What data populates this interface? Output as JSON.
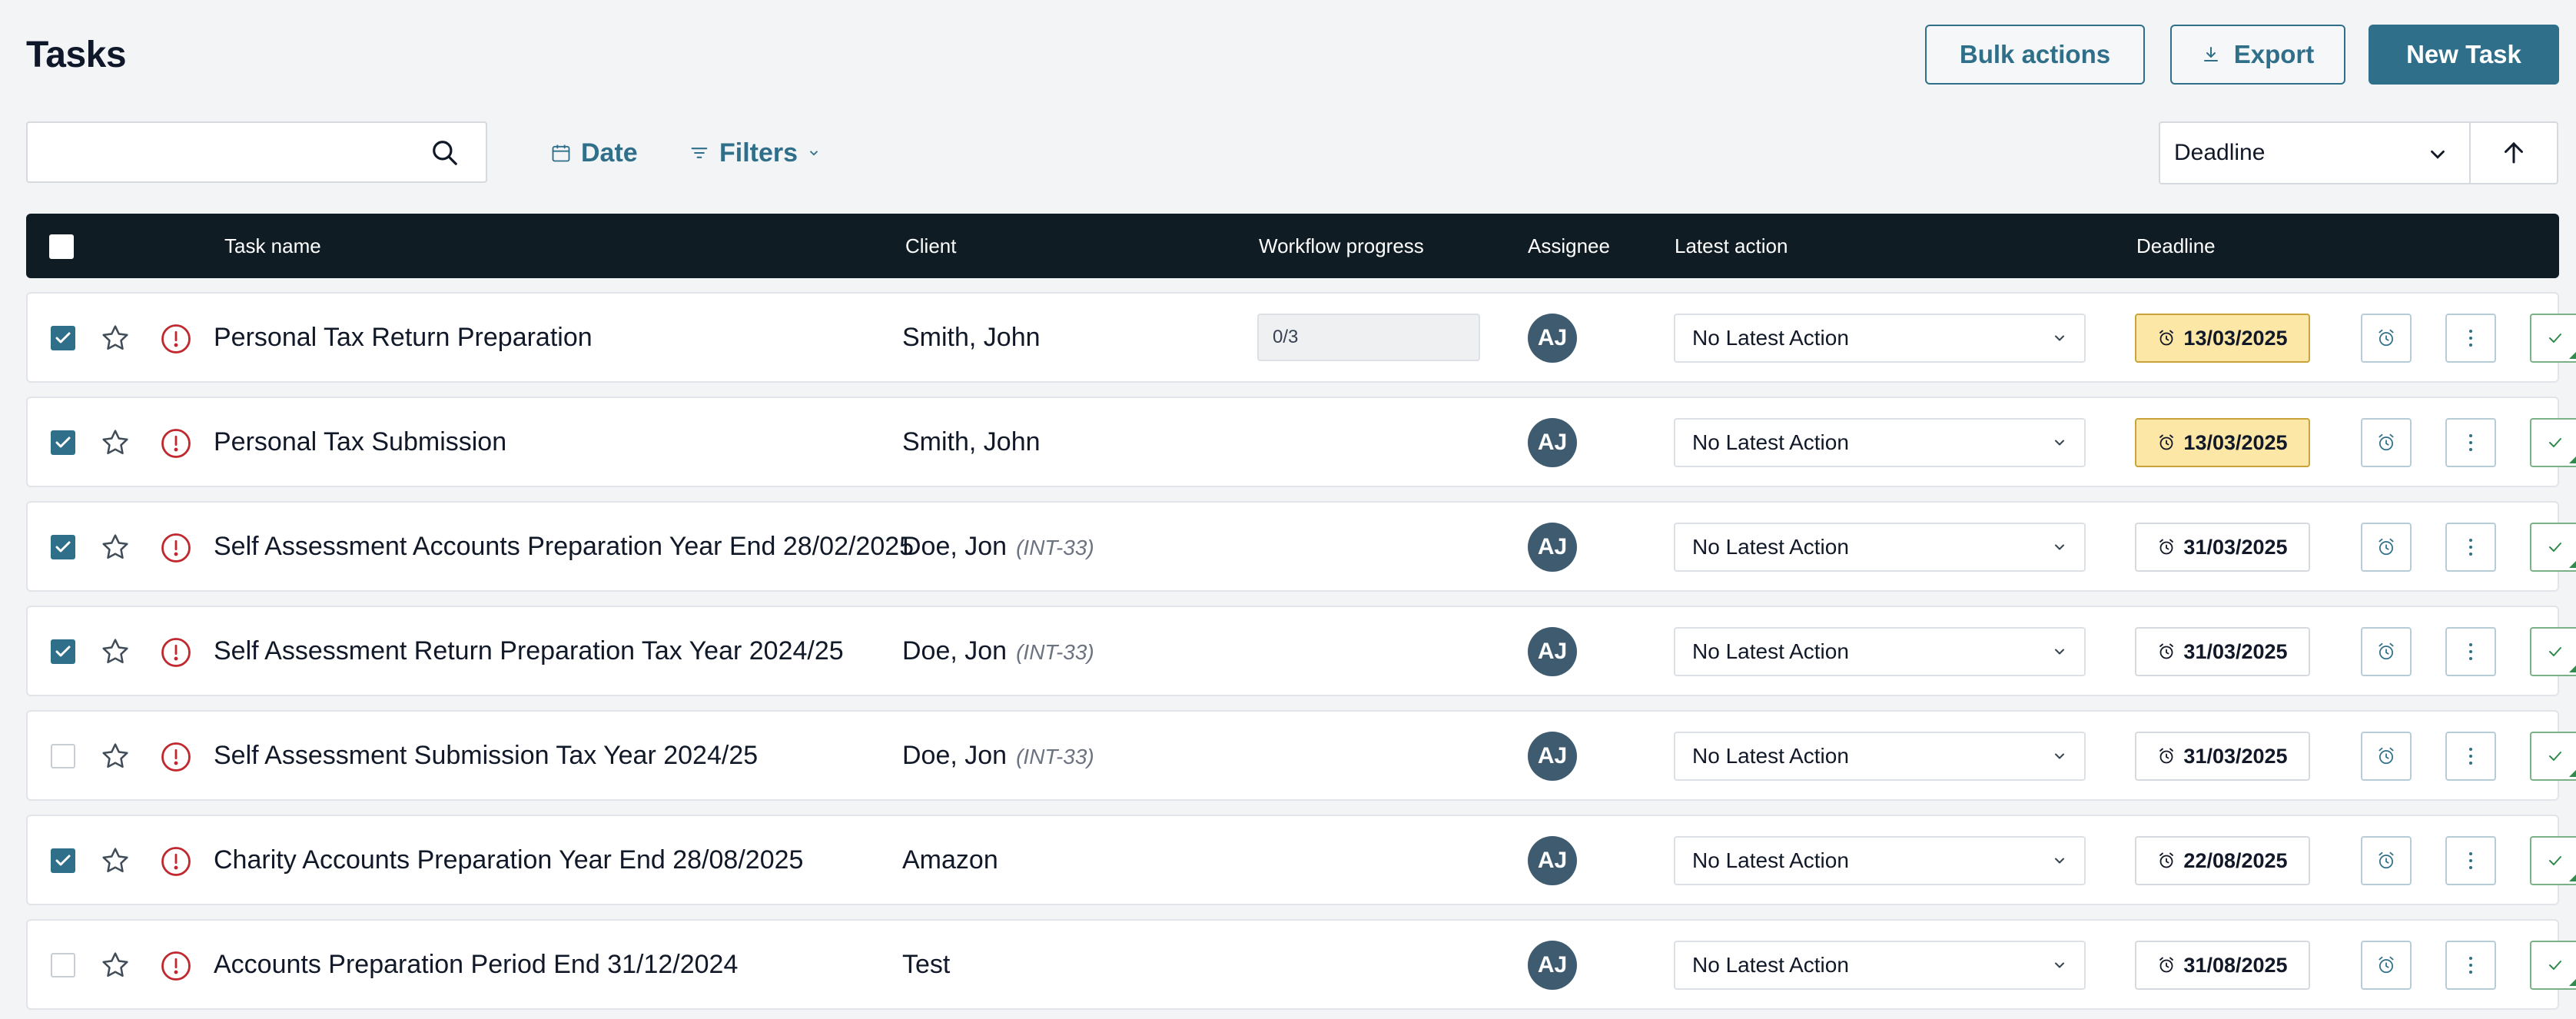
{
  "header": {
    "title": "Tasks",
    "bulk_actions_label": "Bulk actions",
    "export_label": "Export",
    "new_task_label": "New Task"
  },
  "toolbar": {
    "search_value": "",
    "date_label": "Date",
    "filters_label": "Filters",
    "sort_by": "Deadline"
  },
  "table": {
    "columns": {
      "task_name": "Task name",
      "client": "Client",
      "workflow_progress": "Workflow progress",
      "assignee": "Assignee",
      "latest_action": "Latest action",
      "deadline": "Deadline"
    },
    "rows": [
      {
        "checked": true,
        "name": "Personal Tax Return Preparation",
        "client": "Smith, John",
        "client_ref": "",
        "progress": "0/3",
        "assignee": "AJ",
        "latest_action": "No Latest Action",
        "deadline": "13/03/2025",
        "deadline_warning": true
      },
      {
        "checked": true,
        "name": "Personal Tax Submission",
        "client": "Smith, John",
        "client_ref": "",
        "progress": "",
        "assignee": "AJ",
        "latest_action": "No Latest Action",
        "deadline": "13/03/2025",
        "deadline_warning": true
      },
      {
        "checked": true,
        "name": "Self Assessment Accounts Preparation Year End 28/02/2025",
        "client": "Doe, Jon",
        "client_ref": "(INT-33)",
        "progress": "",
        "assignee": "AJ",
        "latest_action": "No Latest Action",
        "deadline": "31/03/2025",
        "deadline_warning": false
      },
      {
        "checked": true,
        "name": "Self Assessment Return Preparation Tax Year 2024/25",
        "client": "Doe, Jon",
        "client_ref": "(INT-33)",
        "progress": "",
        "assignee": "AJ",
        "latest_action": "No Latest Action",
        "deadline": "31/03/2025",
        "deadline_warning": false
      },
      {
        "checked": false,
        "name": "Self Assessment Submission Tax Year 2024/25",
        "client": "Doe, Jon",
        "client_ref": "(INT-33)",
        "progress": "",
        "assignee": "AJ",
        "latest_action": "No Latest Action",
        "deadline": "31/03/2025",
        "deadline_warning": false
      },
      {
        "checked": true,
        "name": "Charity Accounts Preparation Year End 28/08/2025",
        "client": "Amazon",
        "client_ref": "",
        "progress": "",
        "assignee": "AJ",
        "latest_action": "No Latest Action",
        "deadline": "22/08/2025",
        "deadline_warning": false
      },
      {
        "checked": false,
        "name": "Accounts Preparation Period End 31/12/2024",
        "client": "Test",
        "client_ref": "",
        "progress": "",
        "assignee": "AJ",
        "latest_action": "No Latest Action",
        "deadline": "31/08/2025",
        "deadline_warning": false
      }
    ]
  },
  "colors": {
    "accent": "#2f6f8a",
    "header_bg": "#0f1c24",
    "alert_red": "#c0282d",
    "deadline_warning_bg": "#fde7a6",
    "done_green": "#2e8b4a"
  },
  "icons": {
    "search": "search-icon",
    "date": "calendar-icon",
    "filters": "filter-icon",
    "export": "download-icon",
    "sort_direction": "arrow-up-icon",
    "favorite": "star-icon",
    "priority": "alert-circle-icon",
    "deadline": "alarm-clock-icon",
    "more": "more-vertical-icon",
    "complete": "check-icon"
  }
}
